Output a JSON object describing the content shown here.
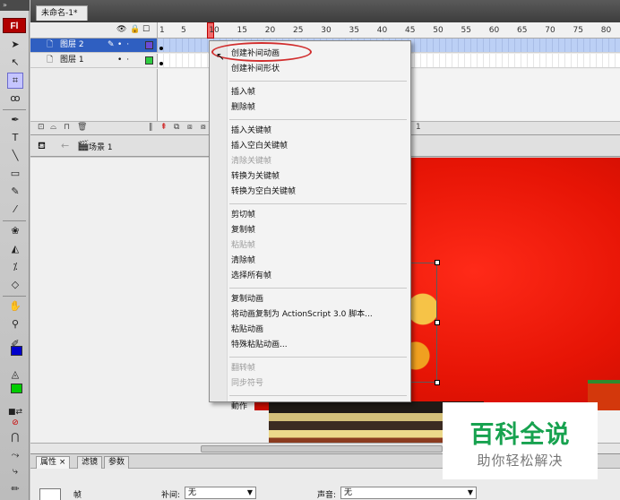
{
  "app": {
    "logo": "Fl",
    "document_tab": "未命名-1*"
  },
  "timeline": {
    "frame_numbers": [
      "1",
      "5",
      "10",
      "15",
      "20",
      "25",
      "30",
      "35",
      "40",
      "45",
      "50",
      "55",
      "60",
      "65",
      "70",
      "75",
      "80"
    ],
    "layers": [
      {
        "name": "图层 2",
        "selected": true,
        "color": "#6b4bd6"
      },
      {
        "name": "图层 1",
        "selected": false,
        "color": "#2ecc40"
      }
    ],
    "bottom_frame_number": "1"
  },
  "scene": {
    "label": "场景 1"
  },
  "context_menu": {
    "items": [
      {
        "label": "创建补间动画",
        "disabled": false
      },
      {
        "label": "创建补间形状",
        "disabled": false
      },
      {
        "sep": true
      },
      {
        "label": "插入帧",
        "disabled": false
      },
      {
        "label": "删除帧",
        "disabled": false
      },
      {
        "sep": true
      },
      {
        "label": "插入关键帧",
        "disabled": false
      },
      {
        "label": "插入空白关键帧",
        "disabled": false
      },
      {
        "label": "清除关键帧",
        "disabled": true
      },
      {
        "label": "转换为关键帧",
        "disabled": false
      },
      {
        "label": "转换为空白关键帧",
        "disabled": false
      },
      {
        "sep": true
      },
      {
        "label": "剪切帧",
        "disabled": false
      },
      {
        "label": "复制帧",
        "disabled": false
      },
      {
        "label": "粘贴帧",
        "disabled": true
      },
      {
        "label": "清除帧",
        "disabled": false
      },
      {
        "label": "选择所有帧",
        "disabled": false
      },
      {
        "sep": true
      },
      {
        "label": "复制动画",
        "disabled": false
      },
      {
        "label": "将动画复制为 ActionScript 3.0 脚本...",
        "disabled": false
      },
      {
        "label": "粘贴动画",
        "disabled": false
      },
      {
        "label": "特殊粘贴动画...",
        "disabled": false
      },
      {
        "sep": true
      },
      {
        "label": "翻转帧",
        "disabled": true
      },
      {
        "label": "同步符号",
        "disabled": true
      },
      {
        "sep": true
      },
      {
        "label": "動作",
        "disabled": false
      }
    ]
  },
  "properties": {
    "tabs": [
      "属性",
      "滤镜",
      "参数"
    ],
    "frame_label": "帧",
    "tween_label": "补间:",
    "tween_value": "无",
    "sound_label": "声音:",
    "sound_value": "无"
  },
  "watermark": {
    "title": "百科全说",
    "subtitle": "助你轻松解决"
  },
  "colors": {
    "accent_red": "#d12e2e",
    "layer_selected": "#2f5fc1",
    "watermark_green": "#17a24f"
  }
}
